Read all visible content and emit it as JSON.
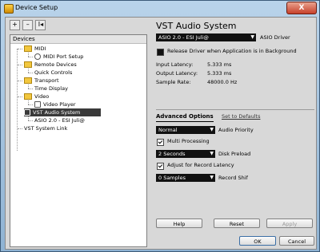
{
  "window": {
    "title": "Device Setup",
    "close_symbol": "X"
  },
  "toolbar": {
    "add": "+",
    "remove": "–",
    "reset": "I◂"
  },
  "devices": {
    "header": "Devices",
    "tree": [
      {
        "label": "MIDI",
        "icon": "folder-icon"
      },
      {
        "label": "MIDI Port Setup",
        "icon": "port-icon"
      },
      {
        "label": "Remote Devices",
        "icon": "folder-icon"
      },
      {
        "label": "Quick Controls",
        "icon": ""
      },
      {
        "label": "Transport",
        "icon": "folder-icon"
      },
      {
        "label": "Time Display",
        "icon": ""
      },
      {
        "label": "Video",
        "icon": "folder-icon"
      },
      {
        "label": "Video Player",
        "icon": "video-icon"
      },
      {
        "label": "VST Audio System",
        "icon": "audio-system-icon",
        "selected": true
      },
      {
        "label": "ASIO 2.0 - ESI Juli@",
        "icon": ""
      },
      {
        "label": "VST System Link",
        "icon": ""
      }
    ]
  },
  "panel": {
    "title": "VST Audio System",
    "asio_driver": {
      "value": "ASIO 2.0 - ESI Juli@",
      "label": "ASIO Driver"
    },
    "release_driver": {
      "label": "Release Driver when Application is in Background",
      "checked": false
    },
    "input_latency": {
      "label": "Input Latency:",
      "value": "5.333 ms"
    },
    "output_latency": {
      "label": "Output Latency:",
      "value": "5.333 ms"
    },
    "sample_rate": {
      "label": "Sample Rate:",
      "value": "48000.0 Hz"
    },
    "tabs": {
      "advanced": "Advanced Options",
      "defaults": "Set to Defaults"
    },
    "audio_priority": {
      "value": "Normal",
      "label": "Audio Priority"
    },
    "multi_processing": {
      "label": "Multi Processing",
      "checked": true
    },
    "disk_preload": {
      "value": "2 Seconds",
      "label": "Disk Preload"
    },
    "adjust_latency": {
      "label": "Adjust for Record Latency",
      "checked": true
    },
    "record_shift": {
      "value": "0 Samples",
      "label": "Record Shif"
    }
  },
  "buttons": {
    "help": "Help",
    "reset": "Reset",
    "apply": "Apply",
    "ok": "OK",
    "cancel": "Cancel"
  },
  "colors": {
    "selected_row": "#3a3a3a",
    "dropdown_bg": "#111111"
  }
}
